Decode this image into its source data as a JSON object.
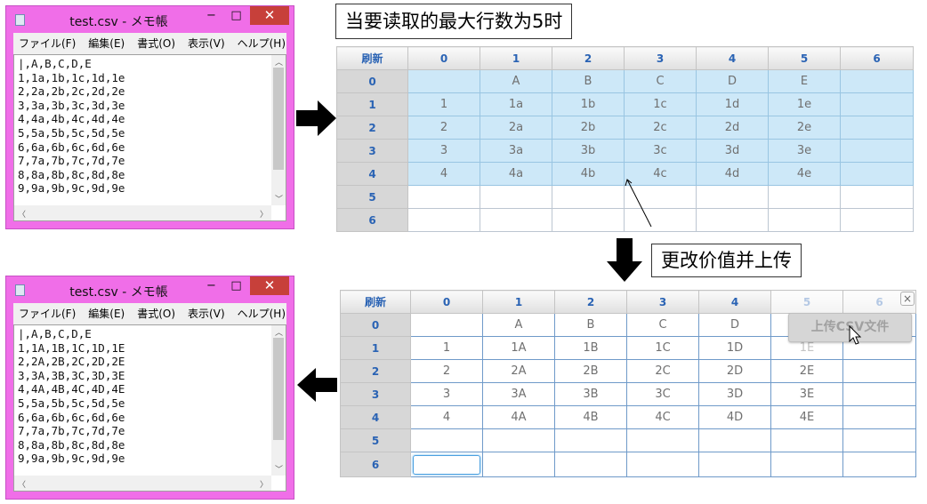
{
  "notepad_top": {
    "title": "test.csv - メモ帳",
    "menu": [
      "ファイル(F)",
      "編集(E)",
      "書式(O)",
      "表示(V)",
      "ヘルプ(H)"
    ],
    "content": "|,A,B,C,D,E\n1,1a,1b,1c,1d,1e\n2,2a,2b,2c,2d,2e\n3,3a,3b,3c,3d,3e\n4,4a,4b,4c,4d,4e\n5,5a,5b,5c,5d,5e\n6,6a,6b,6c,6d,6e\n7,7a,7b,7c,7d,7e\n8,8a,8b,8c,8d,8e\n9,9a,9b,9c,9d,9e"
  },
  "notepad_bottom": {
    "title": "test.csv - メモ帳",
    "menu": [
      "ファイル(F)",
      "編集(E)",
      "書式(O)",
      "表示(V)",
      "ヘルプ(H)"
    ],
    "content": "|,A,B,C,D,E\n1,1A,1B,1C,1D,1E\n2,2A,2B,2C,2D,2E\n3,3A,3B,3C,3D,3E\n4,4A,4B,4C,4D,4E\n5,5a,5b,5c,5d,5e\n6,6a,6b,6c,6d,6e\n7,7a,7b,7c,7d,7e\n8,8a,8b,8c,8d,8e\n9,9a,9b,9c,9d,9e"
  },
  "window_buttons": {
    "minimize": "−",
    "maximize": "□",
    "close": "✕"
  },
  "captions": {
    "top": "当要读取的最大行数为5时",
    "middle": "更改价值并上传"
  },
  "grid_top": {
    "refresh_label": "刷新",
    "col_headers": [
      "0",
      "1",
      "2",
      "3",
      "4",
      "5",
      "6"
    ],
    "row_headers": [
      "0",
      "1",
      "2",
      "3",
      "4",
      "5",
      "6"
    ],
    "rows": [
      [
        "",
        "A",
        "B",
        "C",
        "D",
        "E",
        ""
      ],
      [
        "1",
        "1a",
        "1b",
        "1c",
        "1d",
        "1e",
        ""
      ],
      [
        "2",
        "2a",
        "2b",
        "2c",
        "2d",
        "2e",
        ""
      ],
      [
        "3",
        "3a",
        "3b",
        "3c",
        "3d",
        "3e",
        ""
      ],
      [
        "4",
        "4a",
        "4b",
        "4c",
        "4d",
        "4e",
        ""
      ],
      [
        "",
        "",
        "",
        "",
        "",
        "",
        ""
      ],
      [
        "",
        "",
        "",
        "",
        "",
        "",
        ""
      ]
    ]
  },
  "grid_bottom": {
    "refresh_label": "刷新",
    "col_headers": [
      "0",
      "1",
      "2",
      "3",
      "4",
      "5",
      "6"
    ],
    "row_headers": [
      "0",
      "1",
      "2",
      "3",
      "4",
      "5",
      "6"
    ],
    "rows": [
      [
        "",
        "A",
        "B",
        "C",
        "D",
        "",
        ""
      ],
      [
        "1",
        "1A",
        "1B",
        "1C",
        "1D",
        "1E",
        ""
      ],
      [
        "2",
        "2A",
        "2B",
        "2C",
        "2D",
        "2E",
        ""
      ],
      [
        "3",
        "3A",
        "3B",
        "3C",
        "3D",
        "3E",
        ""
      ],
      [
        "4",
        "4A",
        "4B",
        "4C",
        "4D",
        "4E",
        ""
      ],
      [
        "",
        "",
        "",
        "",
        "",
        "",
        ""
      ],
      [
        "",
        "",
        "",
        "",
        "",
        "",
        ""
      ]
    ],
    "upload_button": "上传CSV文件",
    "close_glyph": "×"
  },
  "colors": {
    "selection": "#cde8f8",
    "header_text": "#2a63b4",
    "notepad_frame": "#f06ee8",
    "close_red": "#c7403a"
  }
}
